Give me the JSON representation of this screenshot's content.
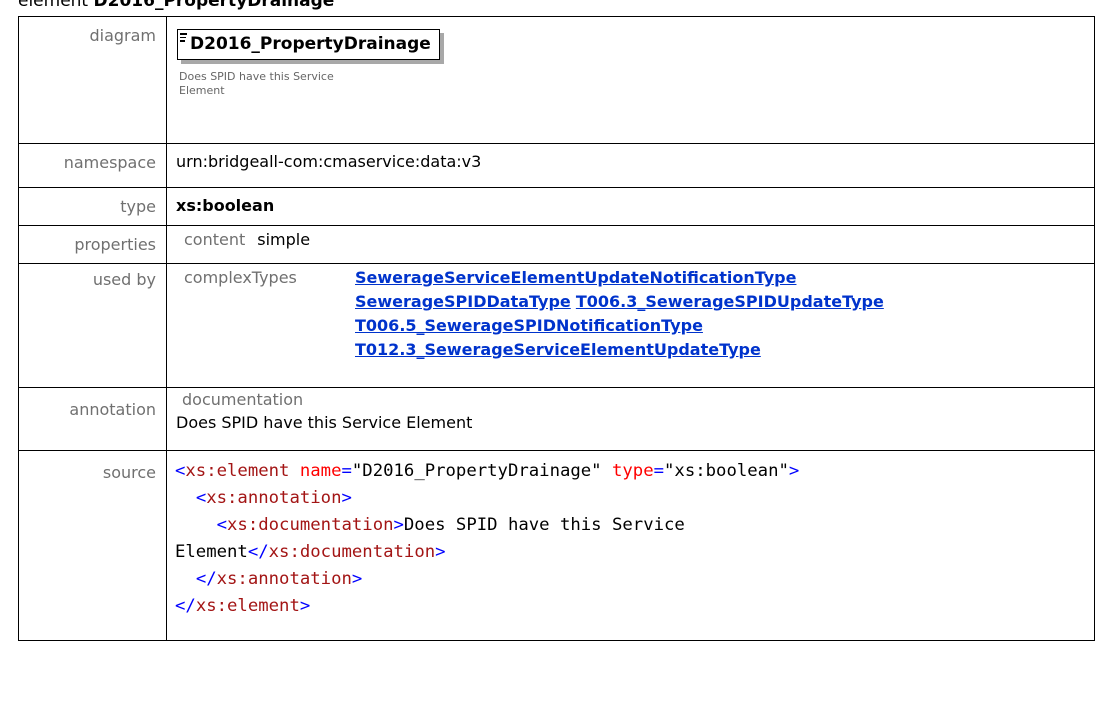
{
  "heading": {
    "prefix": "element",
    "name": "D2016_PropertyDrainage"
  },
  "rows": {
    "diagram": {
      "label": "diagram",
      "element_name": "D2016_PropertyDrainage",
      "doc": "Does SPID have this Service Element"
    },
    "namespace": {
      "label": "namespace",
      "value": "urn:bridgeall-com:cmaservice:data:v3"
    },
    "type": {
      "label": "type",
      "value": "xs:boolean"
    },
    "properties": {
      "label": "properties",
      "key": "content",
      "value": "simple"
    },
    "used_by": {
      "label": "used by",
      "key": "complexTypes",
      "links": [
        "SewerageServiceElementUpdateNotificationType",
        "SewerageSPIDDataType",
        "T006.3_SewerageSPIDUpdateType",
        "T006.5_SewerageSPIDNotificationType",
        "T012.3_SewerageServiceElementUpdateType"
      ]
    },
    "annotation": {
      "label": "annotation",
      "key": "documentation",
      "text": "Does SPID have this Service Element"
    },
    "source": {
      "label": "source",
      "element_tag": "xs:element",
      "attr_name": "name",
      "attr_name_value": "\"D2016_PropertyDrainage\"",
      "attr_type": "type",
      "attr_type_value": "\"xs:boolean\"",
      "annotation_tag": "xs:annotation",
      "documentation_tag": "xs:documentation",
      "doc_text_1": "Does SPID have this Service",
      "doc_text_2": "Element"
    }
  },
  "colors": {
    "link": "#0033cc",
    "label": "#707070",
    "xml_bracket": "#0000ff",
    "xml_tag": "#a31515",
    "xml_attr": "#ff0000"
  }
}
